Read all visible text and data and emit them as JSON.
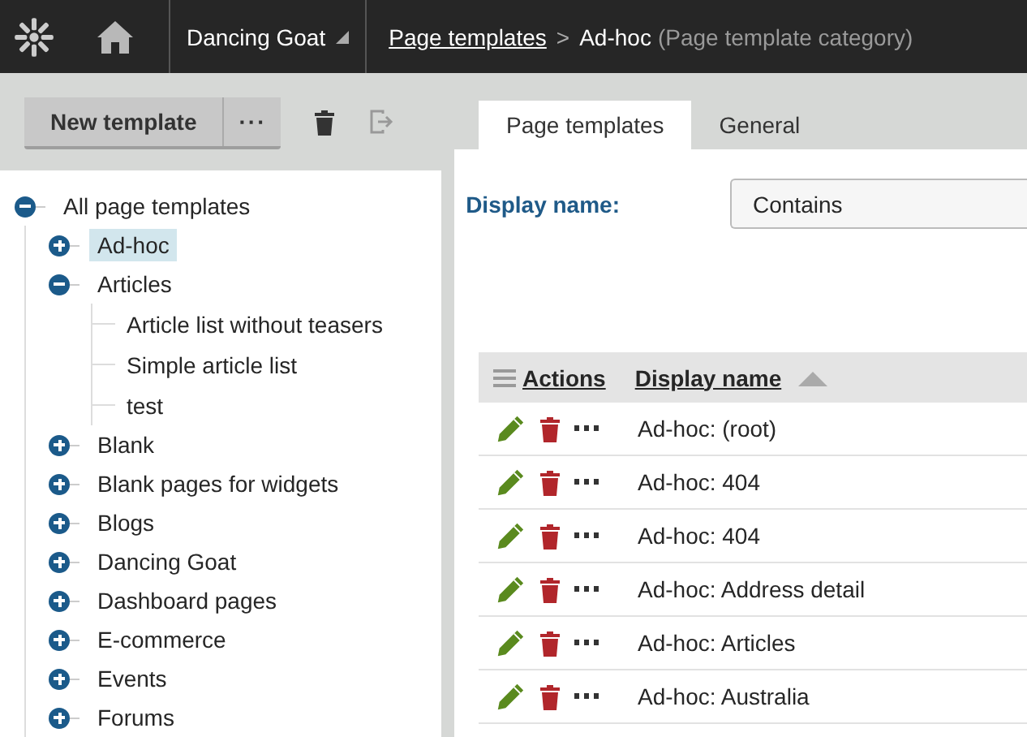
{
  "header": {
    "site": "Dancing Goat",
    "breadcrumb_link": "Page templates",
    "breadcrumb_separator": ">",
    "current": "Ad-hoc",
    "current_type": "(Page template category)"
  },
  "toolbar": {
    "new_button": "New template",
    "more_button": "···",
    "delete_disabled": false,
    "exit_disabled": true
  },
  "tree": [
    {
      "label": "All page templates",
      "expanded": true,
      "selected": false,
      "children": [
        {
          "label": "Ad-hoc",
          "expanded": false,
          "selected": true
        },
        {
          "label": "Articles",
          "expanded": true,
          "selected": false,
          "children": [
            {
              "label": "Article list without teasers",
              "selected": false
            },
            {
              "label": "Simple article list",
              "selected": false
            },
            {
              "label": "test",
              "selected": false
            }
          ]
        },
        {
          "label": "Blank",
          "expanded": false,
          "selected": false
        },
        {
          "label": "Blank pages for widgets",
          "expanded": false,
          "selected": false
        },
        {
          "label": "Blogs",
          "expanded": false,
          "selected": false
        },
        {
          "label": "Dancing Goat",
          "expanded": false,
          "selected": false
        },
        {
          "label": "Dashboard pages",
          "expanded": false,
          "selected": false
        },
        {
          "label": "E-commerce",
          "expanded": false,
          "selected": false
        },
        {
          "label": "Events",
          "expanded": false,
          "selected": false
        },
        {
          "label": "Forums",
          "expanded": false,
          "selected": false
        }
      ]
    }
  ],
  "tabs": [
    {
      "label": "Page templates",
      "selected": true
    },
    {
      "label": "General",
      "selected": false
    }
  ],
  "filter": {
    "label": "Display name:",
    "value": "Contains"
  },
  "table": {
    "columns": [
      "Actions",
      "Display name"
    ],
    "rows": [
      {
        "name": "Ad-hoc: (root)"
      },
      {
        "name": "Ad-hoc: 404"
      },
      {
        "name": "Ad-hoc: 404"
      },
      {
        "name": "Ad-hoc: Address detail"
      },
      {
        "name": "Ad-hoc: Articles"
      },
      {
        "name": "Ad-hoc: Australia"
      }
    ]
  }
}
